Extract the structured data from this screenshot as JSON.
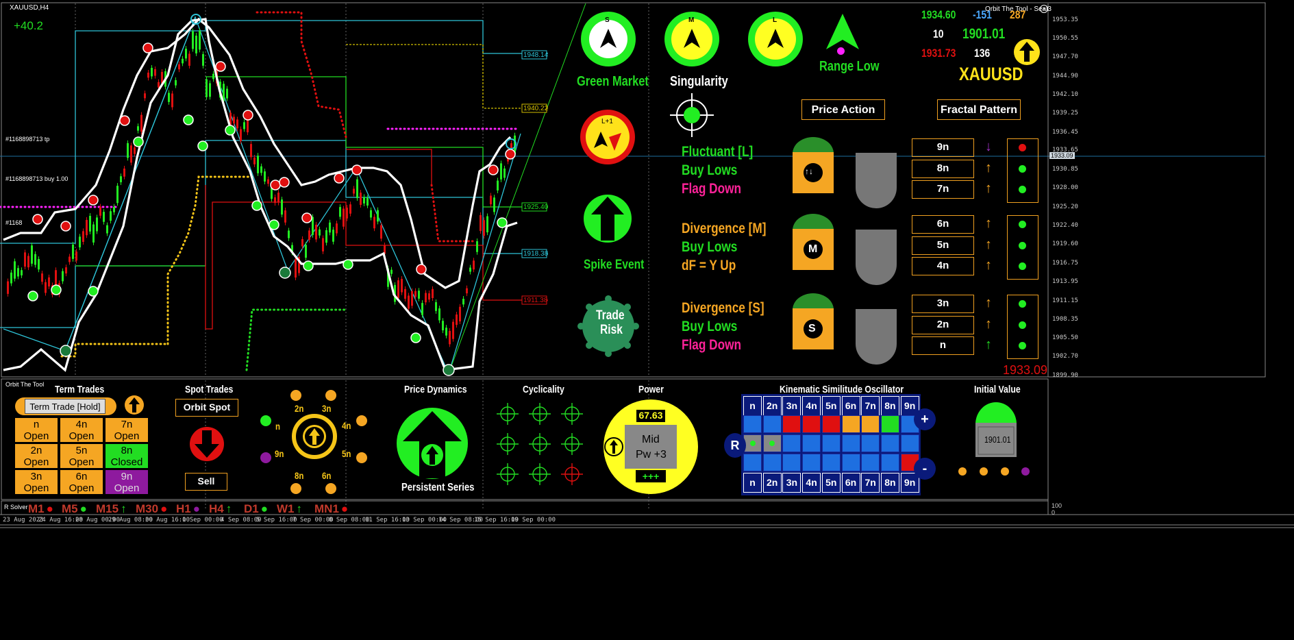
{
  "chart": {
    "symbol": "XAUUSD,H4",
    "profit": "+40.2",
    "order_tp": "#1168898713 tp",
    "order_buy": "#1168898713 buy 1.00",
    "order_partial": "#1168",
    "level_labels": [
      "1948.14",
      "1940.22",
      "1925.40",
      "1918.38",
      "1911.38"
    ],
    "price_axis": [
      "1953.35",
      "1950.55",
      "1947.70",
      "1944.90",
      "1942.10",
      "1939.25",
      "1936.45",
      "1933.65",
      "1933.09",
      "1930.85",
      "1928.00",
      "1925.20",
      "1922.40",
      "1919.60",
      "1916.75",
      "1913.95",
      "1911.15",
      "1908.35",
      "1905.50",
      "1902.70",
      "1899.90"
    ],
    "current_price": "1933.09",
    "time_axis": [
      "23 Aug 2023",
      "24 Aug 16:00",
      "28 Aug 00:00",
      "29 Aug 08:00",
      "30 Aug 16:00",
      "1 Sep 00:00",
      "4 Sep 08:00",
      "5 Sep 16:00",
      "7 Sep 00:00",
      "8 Sep 08:00",
      "11 Sep 16:00",
      "13 Sep 00:00",
      "14 Sep 08:00",
      "15 Sep 16:00",
      "19 Sep 00:00"
    ],
    "subwindow_axis": [
      "100",
      "0"
    ],
    "solver_label": "R Solver"
  },
  "dashboard": {
    "indicator_title": "Orbit The Tool - Seal3",
    "compass": [
      {
        "letter": "S",
        "label": "Green Market"
      },
      {
        "letter": "M",
        "label": "Singularity"
      },
      {
        "letter": "L",
        "label": ""
      }
    ],
    "range_label": "Range Low",
    "lplus": "L+1",
    "spike_label": "Spike Event",
    "trade_risk_line1": "Trade",
    "trade_risk_line2": "Risk",
    "stats": {
      "high": "1934.60",
      "delta": "-151",
      "count_right": "287",
      "ten": "10",
      "mid": "1901.01",
      "low": "1931.73",
      "n136": "136"
    },
    "symbol_big": "XAUUSD",
    "price_action_btn": "Price Action",
    "fractal_pattern_btn": "Fractal Pattern",
    "groups": [
      {
        "l1": "Fluctuant [L]",
        "l2": "Buy Lows",
        "l3": "Flag Down",
        "badge": "↑↓",
        "boxes": [
          "9n",
          "8n",
          "7n"
        ],
        "arrows": [
          "↓",
          "↑",
          "↑"
        ],
        "dots": [
          "red",
          "green",
          "green"
        ]
      },
      {
        "l1": "Divergence [M]",
        "l2": "Buy Lows",
        "l3": "dF = Y Up",
        "badge": "M",
        "boxes": [
          "6n",
          "5n",
          "4n"
        ],
        "arrows": [
          "↑",
          "↑",
          "↑"
        ],
        "dots": [
          "green",
          "green",
          "green"
        ]
      },
      {
        "l1": "Divergence [S]",
        "l2": "Buy Lows",
        "l3": "Flag Down",
        "badge": "S",
        "boxes": [
          "3n",
          "2n",
          "n"
        ],
        "arrows": [
          "↑",
          "↑",
          "↑"
        ],
        "dots": [
          "green",
          "green",
          "green"
        ]
      }
    ],
    "current_price_big": "1933.09"
  },
  "bottom": {
    "tool_label": "Orbit The Tool",
    "term_trades": {
      "title": "Term Trades",
      "button": "Term Trade [Hold]",
      "cells": [
        {
          "l1": "n",
          "l2": "Open",
          "color": "#f5a623"
        },
        {
          "l1": "4n",
          "l2": "Open",
          "color": "#f5a623"
        },
        {
          "l1": "7n",
          "l2": "Open",
          "color": "#f5a623"
        },
        {
          "l1": "2n",
          "l2": "Open",
          "color": "#f5a623"
        },
        {
          "l1": "5n",
          "l2": "Open",
          "color": "#f5a623"
        },
        {
          "l1": "8n",
          "l2": "Closed",
          "color": "#22dd22"
        },
        {
          "l1": "3n",
          "l2": "Open",
          "color": "#f5a623"
        },
        {
          "l1": "6n",
          "l2": "Open",
          "color": "#f5a623"
        },
        {
          "l1": "9n",
          "l2": "Open",
          "color": "#8e1a9e"
        }
      ]
    },
    "spot_trades": {
      "title": "Spot Trades",
      "button": "Orbit Spot",
      "sell": "Sell"
    },
    "orbit_labels": [
      "2n",
      "3n",
      "4n",
      "5n",
      "6n",
      "8n",
      "9n",
      "n"
    ],
    "price_dynamics": {
      "title": "Price Dynamics",
      "label": "Persistent Series"
    },
    "cyclicality": {
      "title": "Cyclicality"
    },
    "power": {
      "title": "Power",
      "value": "67.63",
      "mid1": "Mid",
      "mid2": "Pw +3",
      "plus": "+++"
    },
    "kso": {
      "title": "Kinematic Similitude Oscillator",
      "headers": [
        "n",
        "2n",
        "3n",
        "4n",
        "5n",
        "6n",
        "7n",
        "8n",
        "9n"
      ],
      "row1": [
        "#1e6fe0",
        "#1e6fe0",
        "#e01010",
        "#e01010",
        "#e01010",
        "#f5a623",
        "#f5a623",
        "#22dd22",
        "#1e6fe0"
      ],
      "row2": [
        "#888888",
        "#888888",
        "#1e6fe0",
        "#1e6fe0",
        "#1e6fe0",
        "#1e6fe0",
        "#1e6fe0",
        "#1e6fe0",
        "#1e6fe0"
      ],
      "row3": [
        "#1e6fe0",
        "#1e6fe0",
        "#1e6fe0",
        "#1e6fe0",
        "#1e6fe0",
        "#1e6fe0",
        "#1e6fe0",
        "#1e6fe0",
        "#e01010"
      ],
      "plus": "+",
      "minus": "-",
      "r": "R"
    },
    "initial_value": {
      "title": "Initial Value",
      "value": "1901.01"
    },
    "timeframes": [
      {
        "label": "M1",
        "mark": "●",
        "color": "#e01010"
      },
      {
        "label": "M5",
        "mark": "●",
        "color": "#22dd22"
      },
      {
        "label": "M15",
        "mark": "↑",
        "color": "#22dd22"
      },
      {
        "label": "M30",
        "mark": "●",
        "color": "#e01010"
      },
      {
        "label": "H1",
        "mark": "●",
        "color": "#8e1a9e"
      },
      {
        "label": "H4",
        "mark": "↑",
        "color": "#22dd22"
      },
      {
        "label": "D1",
        "mark": "●",
        "color": "#22dd22"
      },
      {
        "label": "W1",
        "mark": "↑",
        "color": "#22dd22"
      },
      {
        "label": "MN1",
        "mark": "●",
        "color": "#e01010"
      }
    ]
  }
}
